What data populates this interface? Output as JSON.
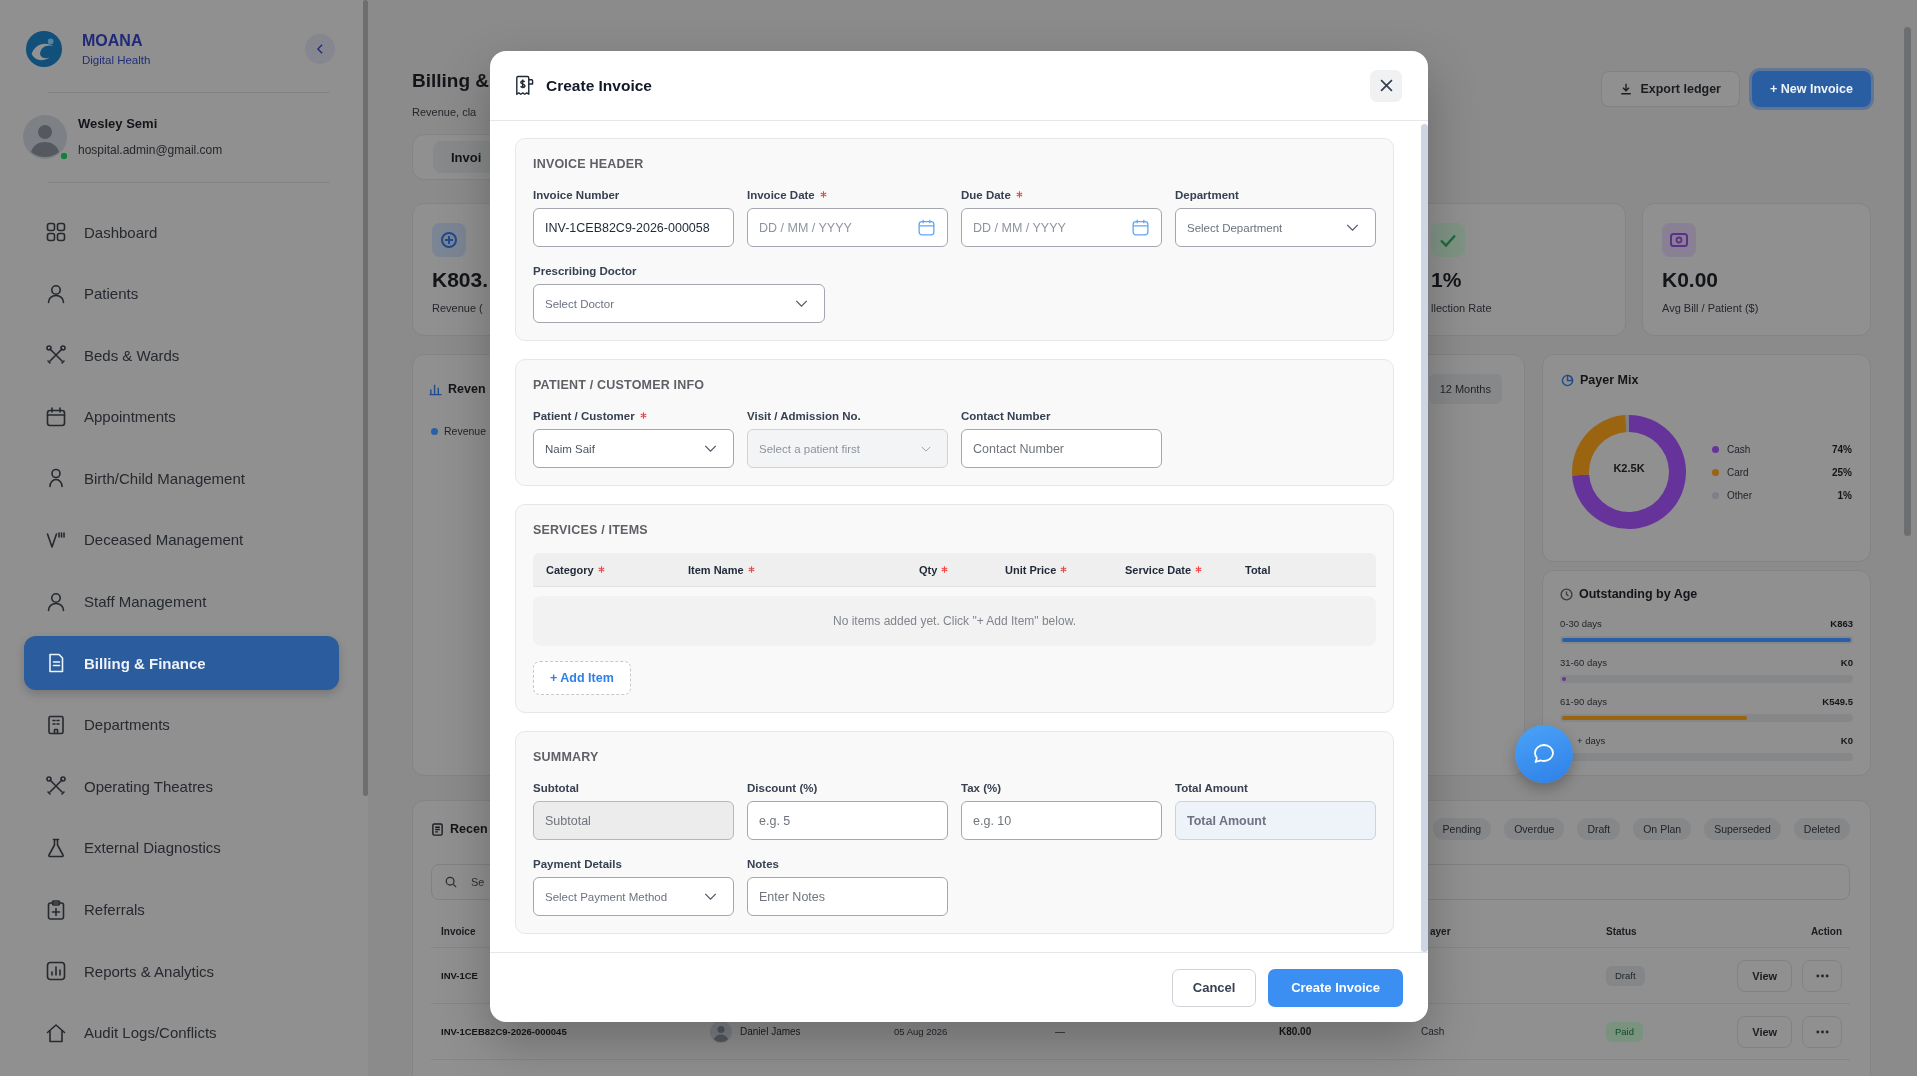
{
  "sidebar": {
    "brand": {
      "name": "MOANA",
      "tagline": "Digital Health"
    },
    "user": {
      "name": "Wesley Semi",
      "email": "hospital.admin@gmail.com",
      "online": true
    },
    "items": [
      {
        "label": "Dashboard",
        "selected": false
      },
      {
        "label": "Patients",
        "selected": false
      },
      {
        "label": "Beds & Wards",
        "selected": false
      },
      {
        "label": "Appointments",
        "selected": false
      },
      {
        "label": "Birth/Child Management",
        "selected": false
      },
      {
        "label": "Deceased Management",
        "selected": false
      },
      {
        "label": "Staff Management",
        "selected": false
      },
      {
        "label": "Billing & Finance",
        "selected": true
      },
      {
        "label": "Departments",
        "selected": false
      },
      {
        "label": "Operating Theatres",
        "selected": false
      },
      {
        "label": "External Diagnostics",
        "selected": false
      },
      {
        "label": "Referrals",
        "selected": false
      },
      {
        "label": "Reports & Analytics",
        "selected": false
      },
      {
        "label": "Audit Logs/Conflicts",
        "selected": false
      }
    ]
  },
  "page": {
    "title": "Billing &",
    "subtitle": "Revenue, cla",
    "actions": [
      {
        "label": "Export ledger",
        "kind": "secondary"
      },
      {
        "label": "+ New Invoice",
        "kind": "primary"
      }
    ],
    "tabs": [
      {
        "label": "Invoi",
        "selected": true
      }
    ],
    "stats": [
      {
        "value": "K803.",
        "label": "Revenue ("
      },
      {
        "value": "1%",
        "label": "llection Rate"
      },
      {
        "value": "K0.00",
        "label": "Avg Bill / Patient ($)"
      }
    ],
    "revenue_chart": {
      "title": "Reven",
      "legend": "Revenue",
      "range": "12 Months"
    },
    "payer_mix": {
      "title": "Payer Mix",
      "center_value": "K2.5K",
      "chart_data": {
        "type": "donut",
        "values": [
          74,
          25,
          1
        ]
      },
      "legend": [
        {
          "label": "Cash",
          "value": "74%",
          "color": "#66339a"
        },
        {
          "label": "Card",
          "value": "25%",
          "color": "#9a6410"
        },
        {
          "label": "Other",
          "value": "1%",
          "color": "#7c8088"
        }
      ]
    },
    "outstanding": {
      "title": "Outstanding by Age",
      "rows": [
        {
          "label": "0-30 days",
          "value": "K863",
          "level": 1,
          "color": "#2a5fa8"
        },
        {
          "label": "31-60 days",
          "value": "K0",
          "level": 0.015,
          "color": "#66339a"
        },
        {
          "label": "61-90 days",
          "value": "K549.5",
          "level": 0.64,
          "color": "#9a6410"
        },
        {
          "label": "+ days",
          "value": "K0"
        }
      ]
    },
    "recent_invoices": {
      "title": "Recen",
      "filters": [
        {
          "label": "Pending",
          "selected": false
        },
        {
          "label": "Overdue",
          "selected": false
        },
        {
          "label": "Draft",
          "selected": false
        },
        {
          "label": "On Plan",
          "selected": false
        },
        {
          "label": "Superseded",
          "selected": false
        },
        {
          "label": "Deleted",
          "selected": false
        }
      ],
      "search": {
        "placeholder": "Se"
      },
      "columns": [
        {
          "label": "Invoice"
        },
        {
          "label": "ayer"
        },
        {
          "label": "Status"
        },
        {
          "label": "Action"
        }
      ],
      "rows": [
        {
          "invoice": "INV-1CE",
          "status": {
            "label": "Draft",
            "kind": "draft"
          },
          "action": "View"
        },
        {
          "invoice": "INV-1CEB82C9-2026-000045",
          "patient": "Daniel James",
          "date": "05 Aug 2026",
          "column_4": "—",
          "amount": "K80.00",
          "payer": "Cash",
          "status": {
            "label": "Paid",
            "kind": "paid"
          },
          "action": "View"
        }
      ]
    }
  },
  "modal": {
    "title": "Create Invoice",
    "sections": [
      {
        "kind": "fields",
        "title": "INVOICE HEADER",
        "fields": [
          {
            "kind": "text",
            "label": "Invoice Number",
            "required": false,
            "disabled": false,
            "value": "INV-1CEB82C9-2026-000058"
          },
          {
            "kind": "date",
            "label": "Invoice Date",
            "required": true,
            "disabled": false,
            "placeholder": "DD / MM / YYYY"
          },
          {
            "kind": "date",
            "label": "Due Date",
            "required": true,
            "disabled": false,
            "placeholder": "DD / MM / YYYY"
          },
          {
            "kind": "select",
            "label": "Department",
            "required": false,
            "disabled": false,
            "placeholder": "Select Department"
          },
          {
            "kind": "select",
            "label": "Prescribing Doctor",
            "required": false,
            "disabled": false,
            "placeholder": "Select Doctor"
          }
        ]
      },
      {
        "kind": "fields",
        "title": "PATIENT / CUSTOMER INFO",
        "fields": [
          {
            "kind": "select",
            "label": "Patient / Customer",
            "required": true,
            "disabled": false,
            "value": "Naim Saif"
          },
          {
            "kind": "select",
            "label": "Visit / Admission No.",
            "required": false,
            "disabled": true,
            "placeholder": "Select a patient first"
          },
          {
            "kind": "text",
            "label": "Contact Number",
            "required": false,
            "disabled": false,
            "placeholder": "Contact Number"
          }
        ]
      },
      {
        "kind": "items",
        "title": "SERVICES / ITEMS",
        "columns": [
          {
            "label": "Category",
            "required": true
          },
          {
            "label": "Item Name",
            "required": true
          },
          {
            "label": "Qty",
            "required": true
          },
          {
            "label": "Unit Price",
            "required": true
          },
          {
            "label": "Service Date",
            "required": true
          },
          {
            "label": "Total",
            "required": false
          }
        ],
        "empty_message": "No items added yet. Click \"+ Add Item\" below.",
        "add_button": "+ Add Item"
      },
      {
        "kind": "fields",
        "title": "SUMMARY",
        "fields": [
          {
            "kind": "readonly",
            "label": "Subtotal",
            "required": false,
            "disabled": false,
            "placeholder": "Subtotal"
          },
          {
            "kind": "text",
            "label": "Discount (%)",
            "required": false,
            "disabled": false,
            "placeholder": "e.g. 5"
          },
          {
            "kind": "text",
            "label": "Tax (%)",
            "required": false,
            "disabled": false,
            "placeholder": "e.g. 10"
          },
          {
            "kind": "total",
            "label": "Total Amount",
            "required": false,
            "disabled": false,
            "placeholder": "Total Amount"
          },
          {
            "kind": "select",
            "label": "Payment Details",
            "required": false,
            "disabled": false,
            "placeholder": "Select Payment Method"
          },
          {
            "kind": "text",
            "label": "Notes",
            "required": false,
            "disabled": false,
            "placeholder": "Enter Notes"
          }
        ]
      }
    ],
    "buttons": [
      {
        "label": "Cancel",
        "kind": "secondary"
      },
      {
        "label": "Create Invoice",
        "kind": "primary"
      }
    ]
  }
}
